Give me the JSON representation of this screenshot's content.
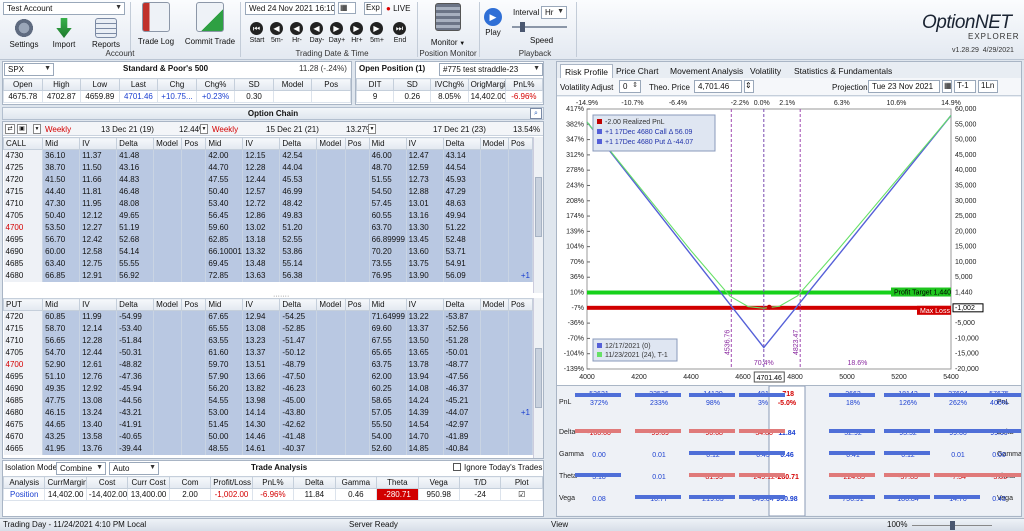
{
  "toolbar": {
    "account": "Test Account",
    "buttons": [
      {
        "label": "Settings",
        "icon": "gear-icon"
      },
      {
        "label": "Import",
        "icon": "import-icon"
      },
      {
        "label": "Reports",
        "icon": "reports-icon"
      },
      {
        "label": "Trade Log",
        "icon": "trade-log-icon"
      },
      {
        "label": "Commit Trade",
        "icon": "commit-trade-icon"
      }
    ],
    "account_group_label": "Account",
    "datetime": "Wed 24 Nov 2021 16:10",
    "exp_label": "Exp",
    "live_label": "LIVE",
    "nav_labels": [
      "Start",
      "5m-",
      "Hr-",
      "Day-",
      "Day+",
      "Hr+",
      "5m+",
      "End"
    ],
    "trading_group_label": "Trading Date & Time",
    "monitor_label": "Monitor",
    "position_monitor_label": "Position Monitor",
    "play_label": "Play",
    "interval_label": "Interval",
    "interval_value": "Hr",
    "speed_label": "Speed",
    "playback_label": "Playback",
    "brand_main": "OptionNET",
    "brand_sub": "EXPLORER",
    "version": "v1.28.29",
    "version_date": "4/29/2021"
  },
  "underlying": {
    "symbol": "SPX",
    "name": "Standard & Poor's 500",
    "change_text": "11.28 (-.24%)",
    "headers": [
      "Open",
      "High",
      "Low",
      "Last",
      "Chg",
      "Chg%",
      "SD",
      "Model",
      "Pos"
    ],
    "values": [
      "4675.78",
      "4702.87",
      "4659.89",
      "4701.46",
      "+10.75...",
      "+0.23%",
      "0.30",
      "",
      ""
    ]
  },
  "open_position": {
    "label": "Open Position (1)",
    "name": "#775 test straddle-23",
    "headers": [
      "DIT",
      "SD",
      "IVChg%",
      "OrigMargin",
      "PnL%"
    ],
    "values": [
      "9",
      "0.26",
      "8.05%",
      "14,402.00",
      "-6.96%"
    ]
  },
  "option_chain": {
    "title": "Option Chain",
    "expirations": [
      {
        "type": "Weekly",
        "date": "13 Dec 21 (19)",
        "iv": "12.44%"
      },
      {
        "type": "Weekly",
        "date": "15 Dec 21 (21)",
        "iv": "13.27%"
      },
      {
        "type": "",
        "date": "17 Dec 21 (23)",
        "iv": "13.54%"
      }
    ],
    "col_headers": [
      "Mid",
      "IV",
      "Delta",
      "Model",
      "Pos"
    ],
    "call_label": "CALL",
    "put_label": "PUT",
    "calls": [
      {
        "strike": "4730",
        "e1": [
          "36.10",
          "11.37",
          "41.48"
        ],
        "e2": [
          "42.00",
          "12.15",
          "42.54"
        ],
        "e3": [
          "46.00",
          "12.47",
          "43.14"
        ],
        "pos3": ""
      },
      {
        "strike": "4725",
        "e1": [
          "38.70",
          "11.50",
          "43.16"
        ],
        "e2": [
          "44.70",
          "12.28",
          "44.04"
        ],
        "e3": [
          "48.70",
          "12.59",
          "44.54"
        ],
        "pos3": ""
      },
      {
        "strike": "4720",
        "e1": [
          "41.50",
          "11.66",
          "44.83"
        ],
        "e2": [
          "47.55",
          "12.44",
          "45.53"
        ],
        "e3": [
          "51.55",
          "12.73",
          "45.93"
        ],
        "pos3": ""
      },
      {
        "strike": "4715",
        "e1": [
          "44.40",
          "11.81",
          "46.48"
        ],
        "e2": [
          "50.40",
          "12.57",
          "46.99"
        ],
        "e3": [
          "54.50",
          "12.88",
          "47.29"
        ],
        "pos3": ""
      },
      {
        "strike": "4710",
        "e1": [
          "47.30",
          "11.95",
          "48.08"
        ],
        "e2": [
          "53.40",
          "12.72",
          "48.42"
        ],
        "e3": [
          "57.45",
          "13.01",
          "48.63"
        ],
        "pos3": ""
      },
      {
        "strike": "4705",
        "e1": [
          "50.40",
          "12.12",
          "49.65"
        ],
        "e2": [
          "56.45",
          "12.86",
          "49.83"
        ],
        "e3": [
          "60.55",
          "13.16",
          "49.94"
        ],
        "pos3": ""
      },
      {
        "strike": "4700",
        "e1": [
          "53.50",
          "12.27",
          "51.19"
        ],
        "e2": [
          "59.60",
          "13.02",
          "51.20"
        ],
        "e3": [
          "63.70",
          "13.30",
          "51.22"
        ],
        "pos3": ""
      },
      {
        "strike": "4695",
        "e1": [
          "56.70",
          "12.42",
          "52.68"
        ],
        "e2": [
          "62.85",
          "13.18",
          "52.55"
        ],
        "e3": [
          "66.89999",
          "13.45",
          "52.48"
        ],
        "pos3": ""
      },
      {
        "strike": "4690",
        "e1": [
          "60.00",
          "12.58",
          "54.14"
        ],
        "e2": [
          "66.10001",
          "13.32",
          "53.86"
        ],
        "e3": [
          "70.20",
          "13.60",
          "53.71"
        ],
        "pos3": ""
      },
      {
        "strike": "4685",
        "e1": [
          "63.40",
          "12.75",
          "55.55"
        ],
        "e2": [
          "69.45",
          "13.48",
          "55.14"
        ],
        "e3": [
          "73.55",
          "13.75",
          "54.91"
        ],
        "pos3": ""
      },
      {
        "strike": "4680",
        "e1": [
          "66.85",
          "12.91",
          "56.92"
        ],
        "e2": [
          "72.85",
          "13.63",
          "56.38"
        ],
        "e3": [
          "76.95",
          "13.90",
          "56.09"
        ],
        "pos3": "+1"
      }
    ],
    "puts": [
      {
        "strike": "4720",
        "e1": [
          "60.85",
          "11.99",
          "-54.99"
        ],
        "e2": [
          "67.65",
          "12.94",
          "-54.25"
        ],
        "e3": [
          "71.64999",
          "13.22",
          "-53.87"
        ],
        "pos3": ""
      },
      {
        "strike": "4715",
        "e1": [
          "58.70",
          "12.14",
          "-53.40"
        ],
        "e2": [
          "65.55",
          "13.08",
          "-52.85"
        ],
        "e3": [
          "69.60",
          "13.37",
          "-52.56"
        ],
        "pos3": ""
      },
      {
        "strike": "4710",
        "e1": [
          "56.65",
          "12.28",
          "-51.84"
        ],
        "e2": [
          "63.55",
          "13.23",
          "-51.47"
        ],
        "e3": [
          "67.55",
          "13.50",
          "-51.28"
        ],
        "pos3": ""
      },
      {
        "strike": "4705",
        "e1": [
          "54.70",
          "12.44",
          "-50.31"
        ],
        "e2": [
          "61.60",
          "13.37",
          "-50.12"
        ],
        "e3": [
          "65.65",
          "13.65",
          "-50.01"
        ],
        "pos3": ""
      },
      {
        "strike": "4700",
        "e1": [
          "52.90",
          "12.61",
          "-48.82"
        ],
        "e2": [
          "59.70",
          "13.51",
          "-48.79"
        ],
        "e3": [
          "63.75",
          "13.78",
          "-48.77"
        ],
        "pos3": ""
      },
      {
        "strike": "4695",
        "e1": [
          "51.10",
          "12.76",
          "-47.36"
        ],
        "e2": [
          "57.90",
          "13.66",
          "-47.50"
        ],
        "e3": [
          "62.00",
          "13.94",
          "-47.56"
        ],
        "pos3": ""
      },
      {
        "strike": "4690",
        "e1": [
          "49.35",
          "12.92",
          "-45.94"
        ],
        "e2": [
          "56.20",
          "13.82",
          "-46.23"
        ],
        "e3": [
          "60.25",
          "14.08",
          "-46.37"
        ],
        "pos3": ""
      },
      {
        "strike": "4685",
        "e1": [
          "47.75",
          "13.08",
          "-44.56"
        ],
        "e2": [
          "54.55",
          "13.98",
          "-45.00"
        ],
        "e3": [
          "58.65",
          "14.24",
          "-45.21"
        ],
        "pos3": ""
      },
      {
        "strike": "4680",
        "e1": [
          "46.15",
          "13.24",
          "-43.21"
        ],
        "e2": [
          "53.00",
          "14.14",
          "-43.80"
        ],
        "e3": [
          "57.05",
          "14.39",
          "-44.07"
        ],
        "pos3": "+1"
      },
      {
        "strike": "4675",
        "e1": [
          "44.65",
          "13.40",
          "-41.91"
        ],
        "e2": [
          "51.45",
          "14.30",
          "-42.62"
        ],
        "e3": [
          "55.50",
          "14.54",
          "-42.97"
        ],
        "pos3": ""
      },
      {
        "strike": "4670",
        "e1": [
          "43.25",
          "13.58",
          "-40.65"
        ],
        "e2": [
          "50.00",
          "14.46",
          "-41.48"
        ],
        "e3": [
          "54.00",
          "14.70",
          "-41.89"
        ],
        "pos3": ""
      },
      {
        "strike": "4665",
        "e1": [
          "41.95",
          "13.76",
          "-39.44"
        ],
        "e2": [
          "48.55",
          "14.61",
          "-40.37"
        ],
        "e3": [
          "52.60",
          "14.85",
          "-40.84"
        ],
        "pos3": ""
      }
    ]
  },
  "trade_analysis": {
    "isolation_label": "Isolation Mode",
    "isolation_value": "Combine",
    "auto_value": "Auto",
    "title": "Trade Analysis",
    "ignore_label": "Ignore Today's Trades",
    "headers": [
      "Analysis",
      "CurrMargin",
      "Cost",
      "Curr Cost",
      "Com",
      "Profit/Loss",
      "PnL%",
      "Delta",
      "Gamma",
      "Theta",
      "Vega",
      "T/D",
      "Plot"
    ],
    "values": [
      "Position",
      "14,402.00",
      "-14,402.00",
      "13,400.00",
      "2.00",
      "-1,002.00",
      "-6.96%",
      "11.84",
      "0.46",
      "-280.71",
      "950.98",
      "-24",
      ""
    ]
  },
  "right": {
    "tabs": [
      "Risk Profile",
      "Price Chart",
      "Movement Analysis",
      "Volatility",
      "Statistics & Fundamentals"
    ],
    "vol_adjust_label": "Volatility Adjust",
    "vol_adjust_value": "0",
    "theo_label": "Theo. Price",
    "theo_value": "4,701.46",
    "projection_label": "Projection",
    "projection_value": "Tue 23 Nov 2021",
    "t1_label": "T-1",
    "one_ln_label": "1Ln",
    "top_pcts": [
      "-14.9%",
      "-10.7%",
      "-6.4%",
      "-2.2%",
      "0.0%",
      "2.1%",
      "6.3%",
      "10.6%",
      "14.9%"
    ],
    "legend": [
      "-2.00  Realized PnL",
      "+1 17Dec 4680 Call Δ  56.09",
      "+1 17Dec 4680 Put Δ  -44.07"
    ],
    "legend2": [
      "12/17/2021 (0)",
      "11/23/2021 (24), T-1"
    ],
    "profit_target": "Profit Target 1,440",
    "max_loss": "Max Loss",
    "current_pnl": "-1,002",
    "be_left": "4536.76",
    "be_right": "4823.47",
    "pct_704": "70.4%",
    "pct_186": "18.6%",
    "current_price": "4701.46",
    "greeks": {
      "labels": [
        "PnL",
        "Delta",
        "Gamma",
        "Theta",
        "Vega"
      ],
      "pnl_top": [
        "53621",
        "33536",
        "14129",
        "481",
        "-718",
        "2662",
        "18142",
        "37694",
        "57675"
      ],
      "pnl_bot": [
        "372%",
        "233%",
        "98%",
        "3%",
        "-5.0%",
        "18%",
        "126%",
        "262%",
        "400%"
      ],
      "delta": [
        "-100.00",
        "-99.69",
        "-90.68",
        "-34.86",
        "11.84",
        "52.92",
        "93.52",
        "99.66",
        "99.99"
      ],
      "gamma": [
        "0.00",
        "0.01",
        "0.12",
        "0.43",
        "0.46",
        "0.41",
        "0.12",
        "0.01",
        "0.00"
      ],
      "theta": [
        "3.18",
        "0.01",
        "-81.95",
        "-249.12",
        "-280.71",
        "-224.85",
        "-57.83",
        "-7.54",
        "-3.33"
      ],
      "vega": [
        "0.08",
        "10.77",
        "219.83",
        "849.04",
        "950.98",
        "756.91",
        "186.84",
        "14.70",
        "0.43"
      ]
    }
  },
  "chart_data": {
    "type": "line",
    "x_ticks": [
      "4000",
      "4200",
      "4400",
      "4600",
      "4800",
      "5000",
      "5200",
      "5400"
    ],
    "xlim": [
      4000,
      5400
    ],
    "y_left_ticks": [
      "417%",
      "382%",
      "347%",
      "312%",
      "278%",
      "243%",
      "208%",
      "174%",
      "139%",
      "104%",
      "70%",
      "36%",
      "10%",
      "-7%",
      "-36%",
      "-70%",
      "-104%",
      "-139%"
    ],
    "y_right_ticks": [
      "60,000",
      "55,000",
      "50,000",
      "45,000",
      "40,000",
      "35,000",
      "30,000",
      "25,000",
      "20,000",
      "15,000",
      "10,000",
      "5,000",
      "1,440",
      "-1,002",
      "-5,000",
      "-10,000",
      "-15,000",
      "-20,000"
    ],
    "ylim": [
      -20000,
      60000
    ],
    "series": [
      {
        "name": "12/17/2021 (0)",
        "color": "#5560d8",
        "x": [
          4000,
          4680,
          5400
        ],
        "y": [
          56000,
          -13400,
          58000
        ]
      },
      {
        "name": "11/23/2021 (24), T-1",
        "color": "#66e066",
        "x": [
          4000,
          4400,
          4550,
          4620,
          4680,
          4740,
          4810,
          4960,
          5400
        ],
        "y": [
          56000,
          16400,
          2400,
          -800,
          -1300,
          -700,
          2500,
          16200,
          58000
        ]
      }
    ],
    "profit_target": 1440,
    "current_pnl": -1002
  }
}
